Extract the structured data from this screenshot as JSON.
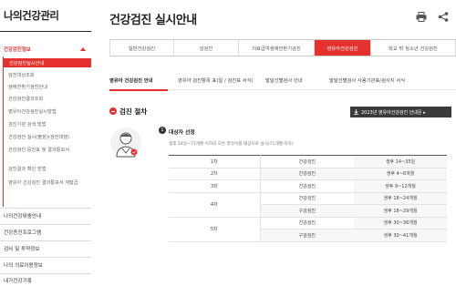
{
  "sidebar": {
    "title": "나의건강관리",
    "group_label": "건강검진정보",
    "active_sub": "건강검진실시안내",
    "sub_items": [
      "검진대상조회",
      "생애전환기검진안내",
      "건강검진결과조회",
      "영유아건강검진실시방법",
      "검진기관 검색 방법",
      "건강검진 실시(출장)(검진대행)",
      "건강검진 문진표 및 결과통보서",
      "검진결과 확인 방법",
      "영유아 건강검진 결과통보서 재발급"
    ],
    "main_items": [
      "나의건강맞춤안내",
      "건강증진프로그램",
      "검사 및 투약정보",
      "나의 의료이용정보",
      "내가건강기록"
    ]
  },
  "header": {
    "title": "건강검진 실시안내",
    "print_icon": "print-icon",
    "share_icon": "share-icon"
  },
  "top_tabs": [
    {
      "label": "일반건강검진",
      "active": false
    },
    {
      "label": "암검진",
      "active": false
    },
    {
      "label": "의료급여생애전환기검진",
      "active": false
    },
    {
      "label": "영유아건강검진",
      "active": true
    },
    {
      "label": "학교 밖 청소년 건강검진",
      "active": false
    }
  ],
  "sub_tabs": [
    {
      "label": "영유아 건강검진 안내",
      "active": true
    },
    {
      "label": "영유아 검진항목 표(일 / 검진표 서식)",
      "active": false
    },
    {
      "label": "발달선별검사 안내",
      "active": false
    },
    {
      "label": "발달선별검사 사용기관표/검사지 서식",
      "active": false
    }
  ],
  "section": {
    "title": "검진 절차",
    "download_label": "2023년 영유아건강검진 안내문 ▸"
  },
  "step": {
    "number": "1",
    "title": "대상자 선정",
    "description": "생후 14일~71개월 이하의 모든 영유아를 대상으로 실시(71개월 이하)"
  },
  "schedule_table": {
    "rows": [
      {
        "round": "1차",
        "type": "건강검진",
        "period": "생후 14~35일",
        "shade": false
      },
      {
        "round": "2차",
        "type": "건강검진",
        "period": "생후 4~6개월",
        "shade": true
      },
      {
        "round": "3차",
        "type": "건강검진",
        "period": "생후 9~12개월",
        "shade": false
      },
      {
        "round": "",
        "type": "건강검진",
        "period": "생후 18~24개월",
        "shade": false
      },
      {
        "round": "4차",
        "type": "구강검진",
        "period": "생후 18~29개월",
        "shade": true
      },
      {
        "round": "",
        "type": "건강검진",
        "period": "생후 30~36개월",
        "shade": false
      },
      {
        "round": "5차",
        "type": "구강검진",
        "period": "생후 30~41개월",
        "shade": true
      }
    ]
  },
  "colors": {
    "accent": "#e5312d",
    "dark": "#3a3a3a"
  }
}
